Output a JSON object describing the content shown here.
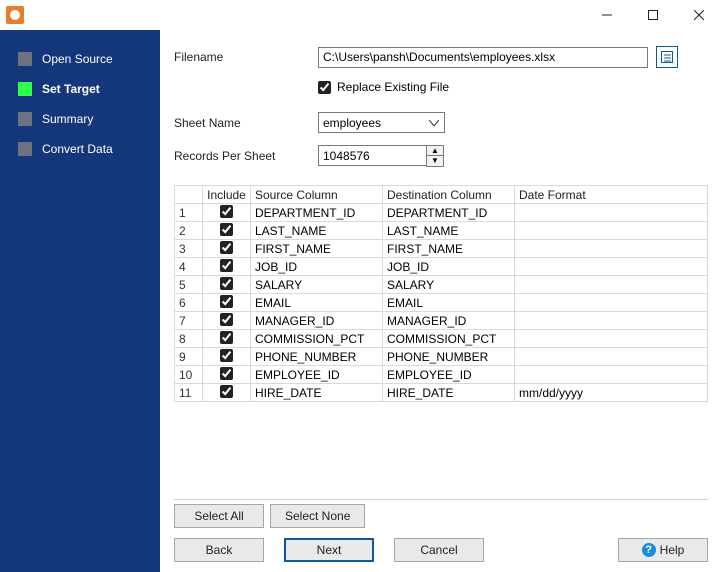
{
  "sidebar": {
    "steps": [
      {
        "label": "Open Source",
        "active": false
      },
      {
        "label": "Set Target",
        "active": true
      },
      {
        "label": "Summary",
        "active": false
      },
      {
        "label": "Convert Data",
        "active": false
      }
    ]
  },
  "form": {
    "filename_label": "Filename",
    "filename_value": "C:\\Users\\pansh\\Documents\\employees.xlsx",
    "replace_label": "Replace Existing File",
    "replace_checked": true,
    "sheet_label": "Sheet Name",
    "sheet_value": "employees",
    "records_label": "Records Per Sheet",
    "records_value": "1048576"
  },
  "grid": {
    "headers": {
      "rownum": "",
      "include": "Include",
      "source": "Source Column",
      "dest": "Destination Column",
      "fmt": "Date Format"
    },
    "rows": [
      {
        "n": "1",
        "inc": true,
        "src": "DEPARTMENT_ID",
        "dst": "DEPARTMENT_ID",
        "fmt": ""
      },
      {
        "n": "2",
        "inc": true,
        "src": "LAST_NAME",
        "dst": "LAST_NAME",
        "fmt": ""
      },
      {
        "n": "3",
        "inc": true,
        "src": "FIRST_NAME",
        "dst": "FIRST_NAME",
        "fmt": ""
      },
      {
        "n": "4",
        "inc": true,
        "src": "JOB_ID",
        "dst": "JOB_ID",
        "fmt": ""
      },
      {
        "n": "5",
        "inc": true,
        "src": "SALARY",
        "dst": "SALARY",
        "fmt": ""
      },
      {
        "n": "6",
        "inc": true,
        "src": "EMAIL",
        "dst": "EMAIL",
        "fmt": ""
      },
      {
        "n": "7",
        "inc": true,
        "src": "MANAGER_ID",
        "dst": "MANAGER_ID",
        "fmt": ""
      },
      {
        "n": "8",
        "inc": true,
        "src": "COMMISSION_PCT",
        "dst": "COMMISSION_PCT",
        "fmt": ""
      },
      {
        "n": "9",
        "inc": true,
        "src": "PHONE_NUMBER",
        "dst": "PHONE_NUMBER",
        "fmt": ""
      },
      {
        "n": "10",
        "inc": true,
        "src": "EMPLOYEE_ID",
        "dst": "EMPLOYEE_ID",
        "fmt": ""
      },
      {
        "n": "11",
        "inc": true,
        "src": "HIRE_DATE",
        "dst": "HIRE_DATE",
        "fmt": "mm/dd/yyyy"
      }
    ]
  },
  "buttons": {
    "select_all": "Select All",
    "select_none": "Select None",
    "back": "Back",
    "next": "Next",
    "cancel": "Cancel",
    "help": "Help"
  }
}
